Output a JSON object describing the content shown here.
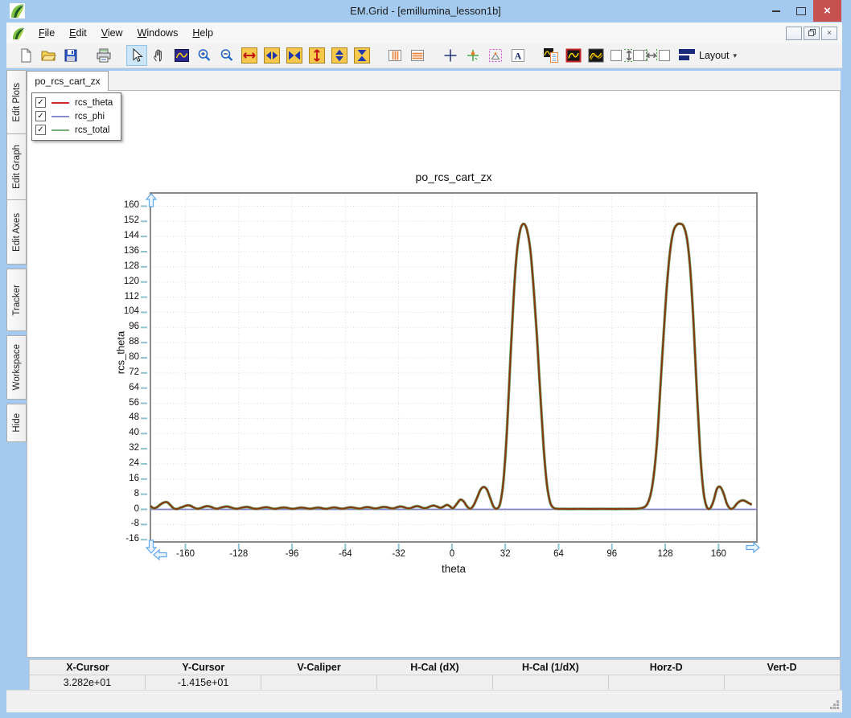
{
  "window": {
    "title": "EM.Grid - [emillumina_lesson1b]",
    "controls": {
      "minimize": "minimize",
      "maximize": "maximize",
      "close": "close"
    }
  },
  "menu": {
    "items": [
      "File",
      "Edit",
      "View",
      "Windows",
      "Help"
    ],
    "mdi_controls": [
      "minimize",
      "restore",
      "close"
    ]
  },
  "toolbar": {
    "groups": [
      [
        "new-file",
        "open-file",
        "save-file"
      ],
      [
        "print"
      ],
      [
        "select-arrow",
        "pan-hand",
        "zoom-window",
        "zoom-in",
        "zoom-out",
        "expand-x",
        "stretch-x",
        "shrink-x",
        "expand-y",
        "stretch-y",
        "shrink-y"
      ],
      [
        "vertical-markers",
        "horizontal-markers"
      ],
      [
        "crosshair",
        "tracker-cursor",
        "caliper-triangle",
        "text-label"
      ],
      [
        "plot-properties",
        "plot-frame",
        "plot-overlay"
      ],
      [
        "align-vertical",
        "align-horizontal"
      ],
      [
        "layout-menu"
      ]
    ],
    "selected": "select-arrow",
    "layout_label": "Layout"
  },
  "sidebar": {
    "tabs": [
      "Edit Plots",
      "Edit Graph",
      "Edit Axes",
      "Tracker",
      "Workspace",
      "Hide"
    ]
  },
  "doc_tab": "po_rcs_cart_zx",
  "legend": {
    "items": [
      {
        "label": "rcs_theta",
        "color": "#CE2B2B",
        "checked": true
      },
      {
        "label": "rcs_phi",
        "color": "#8888CC",
        "checked": true
      },
      {
        "label": "rcs_total",
        "color": "#78AC78",
        "checked": true
      }
    ]
  },
  "chart_data": {
    "type": "line",
    "title": "po_rcs_cart_zx",
    "xlabel": "theta",
    "ylabel": "rcs_theta",
    "xlim": [
      -181.5,
      183.5
    ],
    "ylim": [
      -17.6,
      167.4
    ],
    "x_ticks": [
      -160,
      -128,
      -96,
      -64,
      -32,
      0,
      32,
      64,
      96,
      128,
      160
    ],
    "y_ticks": [
      -16,
      -8,
      0,
      8,
      16,
      24,
      32,
      40,
      48,
      56,
      64,
      72,
      80,
      88,
      96,
      104,
      112,
      120,
      128,
      136,
      144,
      152,
      160
    ],
    "grid": "dotted",
    "legend_position": "top-left-floating",
    "series": [
      {
        "name": "rcs_phi",
        "color": "#8080C8",
        "width": 1.8,
        "z": 1,
        "points": [
          [
            -181,
            0
          ],
          [
            183,
            0
          ]
        ]
      },
      {
        "name": "rcs_total",
        "color": "#6EA56E",
        "width": 3.4,
        "z": 2,
        "points_ref": "rcs_theta"
      },
      {
        "name": "rcs_theta",
        "color": "#86350C",
        "width": 2,
        "z": 3,
        "points": [
          [
            -181,
            1.8
          ],
          [
            -179,
            0.6
          ],
          [
            -177,
            1.2
          ],
          [
            -175,
            2.6
          ],
          [
            -173,
            3.6
          ],
          [
            -171,
            3.8
          ],
          [
            -169,
            2.2
          ],
          [
            -167,
            0.5
          ],
          [
            -165,
            0.2
          ],
          [
            -163,
            0.9
          ],
          [
            -161,
            1.5
          ],
          [
            -159,
            2.1
          ],
          [
            -157,
            1.9
          ],
          [
            -155,
            1.0
          ],
          [
            -153,
            0.3
          ],
          [
            -151,
            0.6
          ],
          [
            -149,
            1.3
          ],
          [
            -147,
            1.7
          ],
          [
            -145,
            1.4
          ],
          [
            -143,
            0.7
          ],
          [
            -141,
            0.3
          ],
          [
            -139,
            0.8
          ],
          [
            -137,
            1.3
          ],
          [
            -135,
            1.5
          ],
          [
            -133,
            1.1
          ],
          [
            -131,
            0.5
          ],
          [
            -129,
            0.3
          ],
          [
            -127,
            0.7
          ],
          [
            -125,
            1.1
          ],
          [
            -123,
            1.3
          ],
          [
            -121,
            0.9
          ],
          [
            -119,
            0.4
          ],
          [
            -117,
            0.3
          ],
          [
            -115,
            0.6
          ],
          [
            -113,
            1.0
          ],
          [
            -111,
            1.1
          ],
          [
            -109,
            0.7
          ],
          [
            -107,
            0.3
          ],
          [
            -105,
            0.4
          ],
          [
            -103,
            0.8
          ],
          [
            -101,
            1.0
          ],
          [
            -99,
            0.8
          ],
          [
            -97,
            0.4
          ],
          [
            -95,
            0.3
          ],
          [
            -93,
            0.6
          ],
          [
            -91,
            0.9
          ],
          [
            -89,
            0.8
          ],
          [
            -87,
            0.5
          ],
          [
            -85,
            0.3
          ],
          [
            -83,
            0.6
          ],
          [
            -81,
            0.9
          ],
          [
            -79,
            0.8
          ],
          [
            -77,
            0.4
          ],
          [
            -75,
            0.3
          ],
          [
            -73,
            0.7
          ],
          [
            -71,
            1.0
          ],
          [
            -69,
            0.8
          ],
          [
            -67,
            0.4
          ],
          [
            -65,
            0.4
          ],
          [
            -63,
            0.8
          ],
          [
            -61,
            1.1
          ],
          [
            -59,
            0.9
          ],
          [
            -57,
            0.5
          ],
          [
            -55,
            0.4
          ],
          [
            -53,
            0.9
          ],
          [
            -51,
            1.2
          ],
          [
            -49,
            1.0
          ],
          [
            -47,
            0.5
          ],
          [
            -45,
            0.5
          ],
          [
            -43,
            1.0
          ],
          [
            -41,
            1.3
          ],
          [
            -39,
            1.1
          ],
          [
            -37,
            0.6
          ],
          [
            -35,
            0.5
          ],
          [
            -33,
            1.1
          ],
          [
            -31,
            1.5
          ],
          [
            -29,
            1.2
          ],
          [
            -27,
            0.6
          ],
          [
            -25,
            0.6
          ],
          [
            -23,
            1.3
          ],
          [
            -21,
            1.7
          ],
          [
            -19,
            1.3
          ],
          [
            -17,
            0.6
          ],
          [
            -15,
            0.8
          ],
          [
            -13,
            1.6
          ],
          [
            -11,
            2.0
          ],
          [
            -9,
            1.5
          ],
          [
            -7,
            0.8
          ],
          [
            -5,
            1.5
          ],
          [
            -3,
            2.4
          ],
          [
            -1,
            1.4
          ],
          [
            0,
            0.6
          ],
          [
            1,
            0.8
          ],
          [
            3,
            3.0
          ],
          [
            5,
            5.1
          ],
          [
            7,
            4.2
          ],
          [
            9,
            1.6
          ],
          [
            11,
            0.3
          ],
          [
            13,
            2.2
          ],
          [
            15,
            6.0
          ],
          [
            17,
            10.2
          ],
          [
            19,
            11.8
          ],
          [
            21,
            10.4
          ],
          [
            23,
            5.8
          ],
          [
            25,
            1.4
          ],
          [
            27,
            0.4
          ],
          [
            29,
            3.5
          ],
          [
            31,
            16
          ],
          [
            33,
            42
          ],
          [
            35,
            78
          ],
          [
            37,
            112
          ],
          [
            39,
            136
          ],
          [
            41,
            147.5
          ],
          [
            43,
            150.7
          ],
          [
            45,
            147.5
          ],
          [
            47,
            137
          ],
          [
            49,
            117
          ],
          [
            51,
            91
          ],
          [
            53,
            61
          ],
          [
            55,
            33
          ],
          [
            57,
            13
          ],
          [
            59,
            3.5
          ],
          [
            61,
            0.8
          ],
          [
            63,
            0.3
          ],
          [
            67,
            0.25
          ],
          [
            72,
            0.2
          ],
          [
            78,
            0.25
          ],
          [
            84,
            0.2
          ],
          [
            90,
            0.25
          ],
          [
            96,
            0.2
          ],
          [
            102,
            0.25
          ],
          [
            108,
            0.25
          ],
          [
            111,
            0.3
          ],
          [
            113,
            0.5
          ],
          [
            115,
            1.0
          ],
          [
            117,
            2.5
          ],
          [
            119,
            7
          ],
          [
            121,
            17
          ],
          [
            123,
            35
          ],
          [
            125,
            63
          ],
          [
            127,
            92
          ],
          [
            129,
            118
          ],
          [
            131,
            137
          ],
          [
            133,
            147
          ],
          [
            135,
            150.2
          ],
          [
            137,
            150.7
          ],
          [
            139,
            149.5
          ],
          [
            141,
            143
          ],
          [
            143,
            127
          ],
          [
            145,
            98
          ],
          [
            147,
            62
          ],
          [
            149,
            30
          ],
          [
            151,
            9
          ],
          [
            153,
            1.2
          ],
          [
            155,
            0.6
          ],
          [
            157,
            4.5
          ],
          [
            159,
            10.8
          ],
          [
            161,
            11.8
          ],
          [
            163,
            8.5
          ],
          [
            165,
            3.0
          ],
          [
            167,
            0.4
          ],
          [
            169,
            0.8
          ],
          [
            171,
            3.0
          ],
          [
            173,
            4.4
          ],
          [
            175,
            4.7
          ],
          [
            177,
            3.9
          ],
          [
            179,
            2.9
          ],
          [
            180,
            2.6
          ]
        ]
      }
    ]
  },
  "cursor_bar": {
    "columns": [
      "X-Cursor",
      "Y-Cursor",
      "V-Caliper",
      "H-Cal (dX)",
      "H-Cal (1/dX)",
      "Horz-D",
      "Vert-D"
    ],
    "values": [
      "3.282e+01",
      "-1.415e+01",
      "",
      "",
      "",
      "",
      ""
    ]
  }
}
